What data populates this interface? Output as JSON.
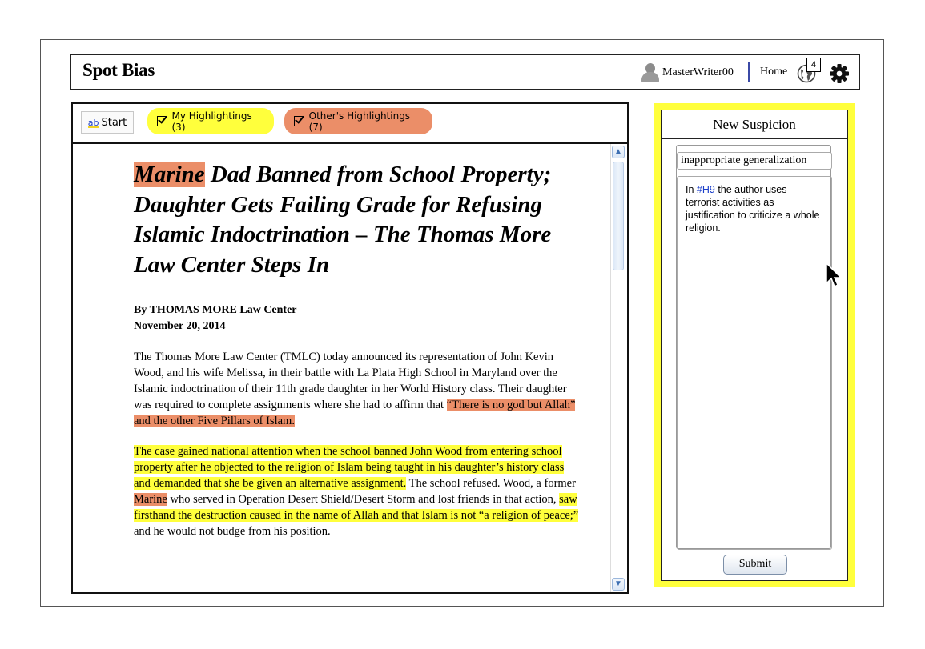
{
  "header": {
    "brand": "Spot Bias",
    "username": "MasterWriter00",
    "home_label": "Home",
    "notification_count": "4",
    "icons": [
      "user-icon",
      "globe-icon",
      "gear-icon"
    ]
  },
  "toolbar": {
    "start_label": "Start",
    "start_icon_text": "ab",
    "my_highlightings": "My Highlightings (3)",
    "others_highlightings": "Other's Highlightings (7)"
  },
  "article": {
    "headline_marked": "Marine",
    "headline_rest": " Dad Banned from School Property; Daughter Gets Failing Grade for Refusing Islamic Indoctrination – The Thomas More Law Center Steps In",
    "byline": "By THOMAS MORE Law Center",
    "date": "November 20, 2014",
    "p1_plain": "The Thomas More Law Center (TMLC) today announced its representation of John Kevin Wood, and his wife Melissa, in their battle with La Plata High School in Maryland over the Islamic indoctrination of their 11th grade daughter in her World History class.  Their daughter was required to complete assignments where she had to affirm that ",
    "p1_marked": "“There is no god but Allah” and the other Five Pillars of Islam.",
    "p2_marked_a": "The case gained national attention when the school banned John Wood from entering school property after he objected to the religion of Islam being taught in his daughter’s history class and demanded that she be given an alternative assignment.",
    "p2_plain_a": " The school refused.  Wood, a former ",
    "p2_marked_b": "Marine",
    "p2_plain_b": " who served in Operation Desert Shield/Desert Storm and lost friends in that action, ",
    "p2_marked_c": "saw firsthand the destruction caused in the name of Allah and that Islam is not “a religion of peace;”",
    "p2_plain_c": " and he would not budge from his position."
  },
  "sidebar": {
    "title": "New Suspicion",
    "category_value": "inappropriate generalization",
    "note_prefix": "In ",
    "note_link": "#H9",
    "note_rest": " the author uses terrorist activities as justification to criticize a whole religion.",
    "submit_label": "Submit"
  },
  "colors": {
    "mine_highlight": "#ffff3c",
    "others_highlight": "#eb8e68",
    "sidebar_bg": "#ffff3c",
    "link": "#1a3ec9"
  }
}
